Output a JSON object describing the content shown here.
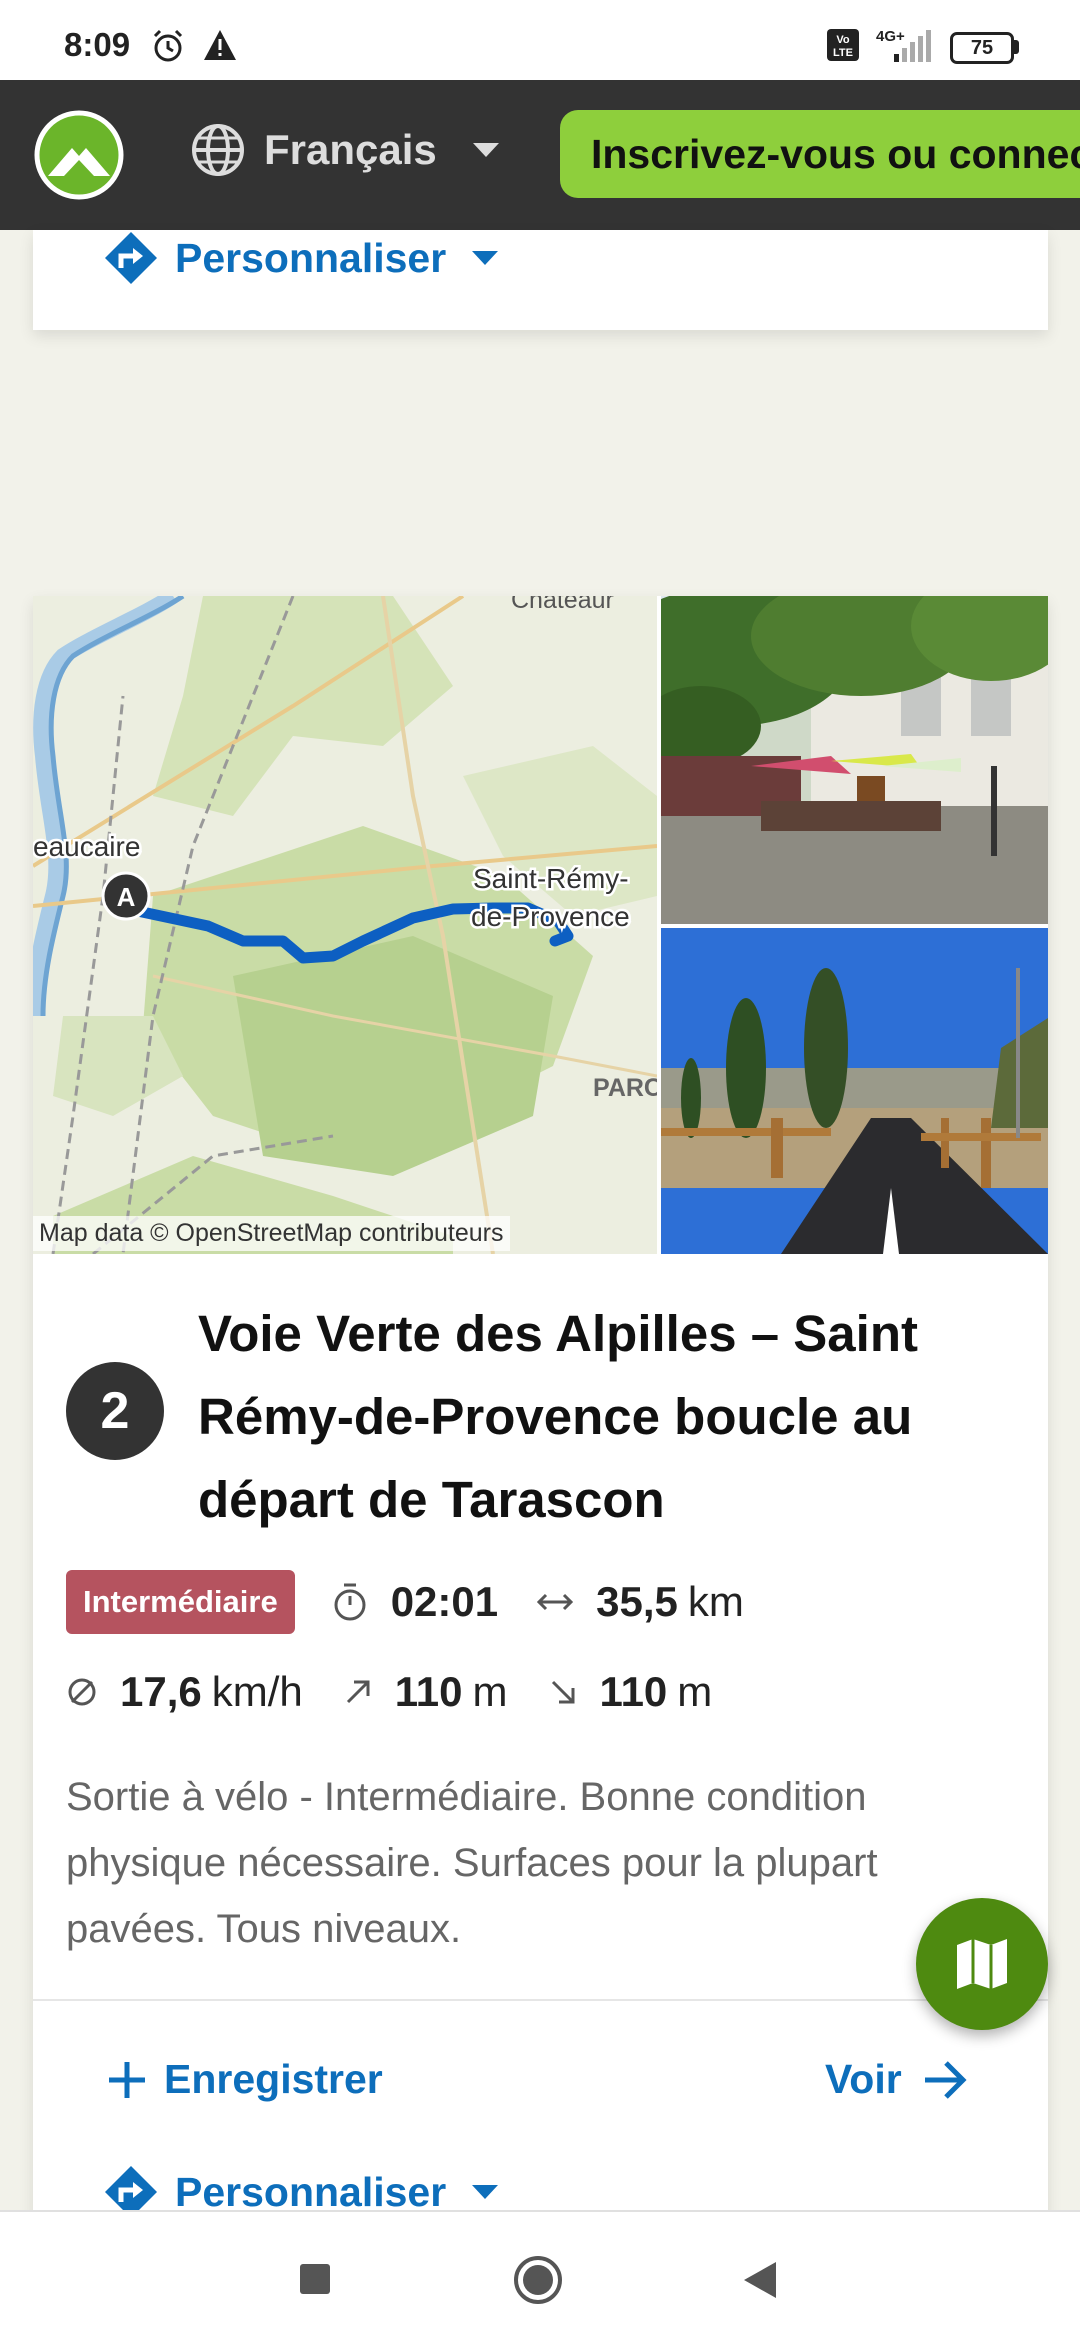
{
  "status_bar": {
    "time": "8:09",
    "battery": "75",
    "network": "4G+"
  },
  "header": {
    "language": "Français",
    "signup": "Inscrivez-vous ou connectez-vous"
  },
  "top_card": {
    "personalize": "Personnaliser"
  },
  "tour": {
    "number": "2",
    "map_labels": {
      "chateau": "Chateaur",
      "beaucaire": "eaucaire",
      "start_marker": "A",
      "srp_line1": "Saint-Rémy-",
      "srp_line2": "de-Provence",
      "parc": "PARC"
    },
    "map_attribution": "Map data © OpenStreetMap contributeurs",
    "title": "Voie Verte des Alpilles – Saint Rémy-de-Provence boucle au départ de Tarascon",
    "difficulty": "Intermédiaire",
    "duration": "02:01",
    "distance_value": "35,5",
    "distance_unit": "km",
    "speed_value": "17,6",
    "speed_unit": "km/h",
    "uphill_value": "110",
    "uphill_unit": "m",
    "downhill_value": "110",
    "downhill_unit": "m",
    "description": "Sortie à vélo - Intermédiaire. Bonne condition physique nécessaire. Surfaces pour la plupart pavées. Tous niveaux.",
    "save": "Enregistrer",
    "view": "Voir",
    "personalize": "Personnaliser"
  },
  "colors": {
    "accent_blue": "#0d6ebb",
    "brand_green": "#8ecf3c",
    "header_bg": "#333333",
    "difficulty_red": "#b5535f",
    "fab_green": "#4e8a10"
  }
}
